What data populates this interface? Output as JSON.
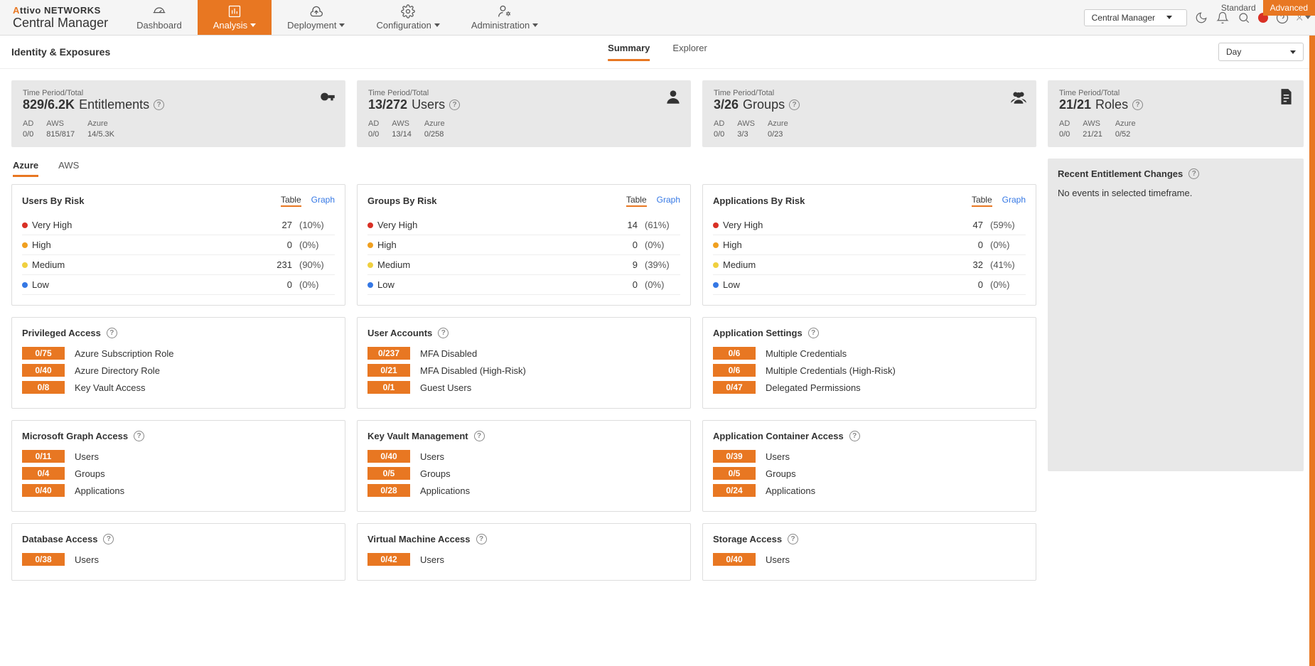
{
  "brand": {
    "part1": "A",
    "part2": "ttivo",
    "part3": " NETWORKS",
    "subtitle": "Central Manager"
  },
  "modePills": {
    "standard": "Standard",
    "advanced": "Advanced"
  },
  "managerSelect": "Central Manager",
  "nav": [
    {
      "label": "Dashboard",
      "active": false,
      "dropdown": false
    },
    {
      "label": "Analysis",
      "active": true,
      "dropdown": true
    },
    {
      "label": "Deployment",
      "active": false,
      "dropdown": true
    },
    {
      "label": "Configuration",
      "active": false,
      "dropdown": true
    },
    {
      "label": "Administration",
      "active": false,
      "dropdown": true
    }
  ],
  "pageTitle": "Identity & Exposures",
  "subTabs": [
    {
      "label": "Summary",
      "active": true
    },
    {
      "label": "Explorer",
      "active": false
    }
  ],
  "timeSelect": "Day",
  "statCards": [
    {
      "periodLabel": "Time Period/Total",
      "main": "829/6.2K",
      "unit": "Entitlements",
      "subs": [
        {
          "h": "AD",
          "v": "0/0"
        },
        {
          "h": "AWS",
          "v": "815/817"
        },
        {
          "h": "Azure",
          "v": "14/5.3K"
        }
      ],
      "icon": "entitlements"
    },
    {
      "periodLabel": "Time Period/Total",
      "main": "13/272",
      "unit": "Users",
      "subs": [
        {
          "h": "AD",
          "v": "0/0"
        },
        {
          "h": "AWS",
          "v": "13/14"
        },
        {
          "h": "Azure",
          "v": "0/258"
        }
      ],
      "icon": "user"
    },
    {
      "periodLabel": "Time Period/Total",
      "main": "3/26",
      "unit": "Groups",
      "subs": [
        {
          "h": "AD",
          "v": "0/0"
        },
        {
          "h": "AWS",
          "v": "3/3"
        },
        {
          "h": "Azure",
          "v": "0/23"
        }
      ],
      "icon": "groups"
    },
    {
      "periodLabel": "Time Period/Total",
      "main": "21/21",
      "unit": "Roles",
      "subs": [
        {
          "h": "AD",
          "v": "0/0"
        },
        {
          "h": "AWS",
          "v": "21/21"
        },
        {
          "h": "Azure",
          "v": "0/52"
        }
      ],
      "icon": "roles"
    }
  ],
  "cloudTabs": [
    {
      "label": "Azure",
      "active": true
    },
    {
      "label": "AWS",
      "active": false
    }
  ],
  "riskPanels": [
    {
      "title": "Users By Risk",
      "toggle": {
        "table": "Table",
        "graph": "Graph",
        "active": "table"
      },
      "rows": [
        {
          "level": "vh",
          "label": "Very High",
          "count": "27",
          "pct": "(10%)"
        },
        {
          "level": "h",
          "label": "High",
          "count": "0",
          "pct": "(0%)"
        },
        {
          "level": "m",
          "label": "Medium",
          "count": "231",
          "pct": "(90%)"
        },
        {
          "level": "l",
          "label": "Low",
          "count": "0",
          "pct": "(0%)"
        }
      ]
    },
    {
      "title": "Groups By Risk",
      "toggle": {
        "table": "Table",
        "graph": "Graph",
        "active": "table"
      },
      "rows": [
        {
          "level": "vh",
          "label": "Very High",
          "count": "14",
          "pct": "(61%)"
        },
        {
          "level": "h",
          "label": "High",
          "count": "0",
          "pct": "(0%)"
        },
        {
          "level": "m",
          "label": "Medium",
          "count": "9",
          "pct": "(39%)"
        },
        {
          "level": "l",
          "label": "Low",
          "count": "0",
          "pct": "(0%)"
        }
      ]
    },
    {
      "title": "Applications By Risk",
      "toggle": {
        "table": "Table",
        "graph": "Graph",
        "active": "table"
      },
      "rows": [
        {
          "level": "vh",
          "label": "Very High",
          "count": "47",
          "pct": "(59%)"
        },
        {
          "level": "h",
          "label": "High",
          "count": "0",
          "pct": "(0%)"
        },
        {
          "level": "m",
          "label": "Medium",
          "count": "32",
          "pct": "(41%)"
        },
        {
          "level": "l",
          "label": "Low",
          "count": "0",
          "pct": "(0%)"
        }
      ]
    }
  ],
  "detailRows": [
    [
      {
        "title": "Privileged Access",
        "items": [
          {
            "badge": "0/75",
            "label": "Azure Subscription Role"
          },
          {
            "badge": "0/40",
            "label": "Azure Directory Role"
          },
          {
            "badge": "0/8",
            "label": "Key Vault Access"
          }
        ]
      },
      {
        "title": "User Accounts",
        "items": [
          {
            "badge": "0/237",
            "label": "MFA Disabled"
          },
          {
            "badge": "0/21",
            "label": "MFA Disabled (High-Risk)"
          },
          {
            "badge": "0/1",
            "label": "Guest Users"
          }
        ]
      },
      {
        "title": "Application Settings",
        "items": [
          {
            "badge": "0/6",
            "label": "Multiple Credentials"
          },
          {
            "badge": "0/6",
            "label": "Multiple Credentials (High-Risk)"
          },
          {
            "badge": "0/47",
            "label": "Delegated Permissions"
          }
        ]
      }
    ],
    [
      {
        "title": "Microsoft Graph Access",
        "items": [
          {
            "badge": "0/11",
            "label": "Users"
          },
          {
            "badge": "0/4",
            "label": "Groups"
          },
          {
            "badge": "0/40",
            "label": "Applications"
          }
        ]
      },
      {
        "title": "Key Vault Management",
        "items": [
          {
            "badge": "0/40",
            "label": "Users"
          },
          {
            "badge": "0/5",
            "label": "Groups"
          },
          {
            "badge": "0/28",
            "label": "Applications"
          }
        ]
      },
      {
        "title": "Application Container Access",
        "items": [
          {
            "badge": "0/39",
            "label": "Users"
          },
          {
            "badge": "0/5",
            "label": "Groups"
          },
          {
            "badge": "0/24",
            "label": "Applications"
          }
        ]
      }
    ],
    [
      {
        "title": "Database Access",
        "items": [
          {
            "badge": "0/38",
            "label": "Users"
          }
        ]
      },
      {
        "title": "Virtual Machine Access",
        "items": [
          {
            "badge": "0/42",
            "label": "Users"
          }
        ]
      },
      {
        "title": "Storage Access",
        "items": [
          {
            "badge": "0/40",
            "label": "Users"
          }
        ]
      }
    ]
  ],
  "rightPanel": {
    "title": "Recent Entitlement Changes",
    "message": "No events in selected timeframe."
  },
  "helpGlyph": "?"
}
